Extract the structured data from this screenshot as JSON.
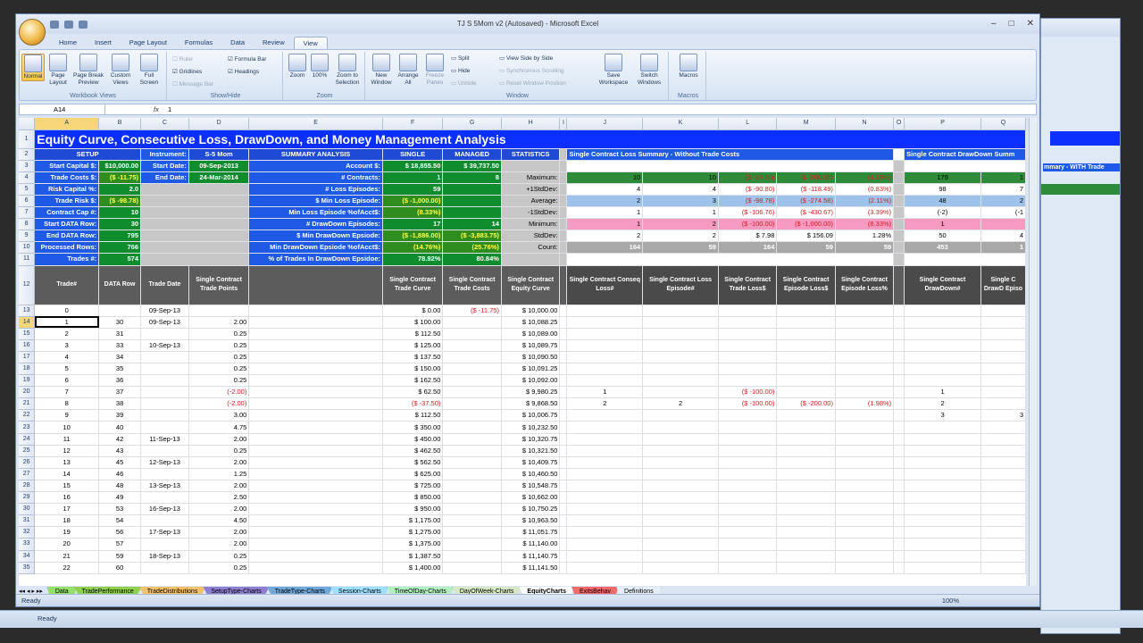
{
  "app": {
    "title": "TJ S 5Mom v2 (Autosaved) - Microsoft Excel",
    "status": "Ready",
    "zoom": "100%"
  },
  "tabs": [
    "Home",
    "Insert",
    "Page Layout",
    "Formulas",
    "Data",
    "Review",
    "View"
  ],
  "ribbon": {
    "workbook_views": {
      "label": "Workbook Views",
      "buttons": [
        "Normal",
        "Page Layout",
        "Page Break Preview",
        "Custom Views",
        "Full Screen"
      ]
    },
    "show_hide": {
      "label": "Show/Hide",
      "items": [
        "Ruler",
        "Formula Bar",
        "Gridlines",
        "Headings",
        "Message Bar"
      ]
    },
    "zoom": {
      "label": "Zoom",
      "buttons": [
        "Zoom",
        "100%",
        "Zoom to Selection"
      ]
    },
    "window": {
      "label": "Window",
      "buttons": [
        "New Window",
        "Arrange All",
        "Freeze Panes",
        "Save Workspace",
        "Switch Windows"
      ],
      "items": [
        "Split",
        "Hide",
        "Unhide",
        "View Side by Side",
        "Synchronous Scrolling",
        "Reset Window Position"
      ]
    },
    "macros": {
      "label": "Macros",
      "buttons": [
        "Macros"
      ]
    }
  },
  "formula": {
    "cell": "A14",
    "fx": "fx",
    "value": "1"
  },
  "columns": [
    "A",
    "B",
    "C",
    "D",
    "E",
    "F",
    "G",
    "H",
    "I",
    "J",
    "K",
    "L",
    "M",
    "N",
    "O",
    "P",
    "Q"
  ],
  "banner": "Equity Curve, Consecutive Loss, DrawDown, and Money Management Analysis",
  "setup": {
    "header": "SETUP",
    "instrument_label": "Instrument:",
    "instrument": "S-5 Mom",
    "rows": [
      [
        "Start Capital $:",
        "$10,000.00",
        "Start Date:",
        "09-Sep-2013"
      ],
      [
        "Trade Costs $:",
        "($ -11.75)",
        "End Date:",
        "24-Mar-2014"
      ],
      [
        "Risk Capital %:",
        "2.0",
        "",
        " "
      ],
      [
        "Trade Risk $:",
        "($ -98.78)",
        "",
        ""
      ],
      [
        "Contract Cap #:",
        "10",
        "",
        ""
      ],
      [
        "Start DATA Row:",
        "30",
        "",
        ""
      ],
      [
        "End DATA Row:",
        "795",
        "",
        ""
      ],
      [
        "Processed Rows:",
        "766",
        "",
        ""
      ],
      [
        "Trades #:",
        "574",
        "",
        ""
      ]
    ]
  },
  "summary": {
    "headers": [
      "SUMMARY ANALYSIS",
      "SINGLE",
      "MANAGED",
      "STATISTICS"
    ],
    "rows": [
      [
        "Account $:",
        "$     18,855.50",
        "$     39,737.50"
      ],
      [
        "# Contracts:",
        "1",
        "8"
      ],
      [
        "# Loss Episodes:",
        "59",
        ""
      ],
      [
        "$ Min Loss Episode:",
        "($     -1,000.00)",
        ""
      ],
      [
        "Min Loss Episode %ofAcct$:",
        "(8.33%)",
        ""
      ],
      [
        "# DrawDown Episodes:",
        "17",
        "14"
      ],
      [
        "$ Min DrawDown Epsiode:",
        "($     -1,886.00)",
        "($     -3,883.75)"
      ],
      [
        "Min DrawDown Epsiode %ofAcct$:",
        "(14.76%)",
        "(25.76%)"
      ],
      [
        "% of Trades In DrawDown Epsidoe:",
        "78.92%",
        "80.84%"
      ]
    ],
    "stats": [
      "Maximum:",
      "+1StdDev:",
      "Average:",
      "-1StdDev:",
      "Minimum:",
      "StdDev:",
      "Count:"
    ]
  },
  "loss_summary": {
    "title": "Single Contract Loss Summary - Without Trade Costs",
    "dd_title": "Single Contract DrawDown Summ",
    "rows": [
      [
        "10",
        "10",
        "($ -37.50)",
        "($ -200.00)",
        "(1.16%)",
        "179",
        "1"
      ],
      [
        "4",
        "4",
        "($ -90.80)",
        "($ -118.49)",
        "(0.83%)",
        "98",
        "7"
      ],
      [
        "2",
        "3",
        "($ -98.78)",
        "($ -274.58)",
        "(2.11%)",
        "48",
        "2"
      ],
      [
        "1",
        "1",
        "($ -106.76)",
        "($ -430.67)",
        "(3.39%)",
        "(-2)",
        "(-1"
      ],
      [
        "1",
        "2",
        "($ -100.00)",
        "($ -1,000.00)",
        "(8.33%)",
        "1",
        ""
      ],
      [
        "2",
        "2",
        "$     7.98",
        "$     156.09",
        "1.28%",
        "50",
        "4"
      ],
      [
        "164",
        "59",
        "164",
        "59",
        "59",
        "453",
        "1"
      ]
    ]
  },
  "table_headers": [
    "Trade#",
    "DATA Row",
    "Trade Date",
    "Single Contract Trade Points",
    "",
    "Single Contract Trade Curve",
    "Single Contract Trade Costs",
    "Single Contract Equity Curve",
    "",
    "Single Contract Conseq Loss#",
    "Single Contract Loss Episode#",
    "Single Contract Trade Loss$",
    "Single Contract Episode Loss$",
    "Single Contract Episode Loss%",
    "",
    "Single Contract DrawDown#",
    "Single C DrawD Episo"
  ],
  "trades": [
    [
      "0",
      "",
      "09-Sep-13",
      "",
      "$ 0.00",
      "($ -11.75)",
      "$ 10,000.00",
      "",
      "",
      "",
      "",
      "",
      "",
      ""
    ],
    [
      "1",
      "30",
      "09-Sep-13",
      "2.00",
      "$ 100.00",
      "",
      "$ 10,088.25",
      "",
      "",
      "",
      "",
      "",
      "",
      ""
    ],
    [
      "2",
      "31",
      "",
      "0.25",
      "$ 112.50",
      "",
      "$ 10,089.00",
      "",
      "",
      "",
      "",
      "",
      "",
      ""
    ],
    [
      "3",
      "33",
      "10-Sep-13",
      "0.25",
      "$ 125.00",
      "",
      "$ 10,089.75",
      "",
      "",
      "",
      "",
      "",
      "",
      ""
    ],
    [
      "4",
      "34",
      "",
      "0.25",
      "$ 137.50",
      "",
      "$ 10,090.50",
      "",
      "",
      "",
      "",
      "",
      "",
      ""
    ],
    [
      "5",
      "35",
      "",
      "0.25",
      "$ 150.00",
      "",
      "$ 10,091.25",
      "",
      "",
      "",
      "",
      "",
      "",
      ""
    ],
    [
      "6",
      "36",
      "",
      "0.25",
      "$ 162.50",
      "",
      "$ 10,092.00",
      "",
      "",
      "",
      "",
      "",
      "",
      ""
    ],
    [
      "7",
      "37",
      "",
      "(-2.00)",
      "$ 62.50",
      "",
      "$ 9,980.25",
      "1",
      "",
      "($ -100.00)",
      "",
      "",
      "1",
      ""
    ],
    [
      "8",
      "38",
      "",
      "(-2.00)",
      "($ -37.50)",
      "",
      "$ 9,868.50",
      "2",
      "2",
      "($ -100.00)",
      "($ -200.00)",
      "(1.98%)",
      "2",
      ""
    ],
    [
      "9",
      "39",
      "",
      "3.00",
      "$ 112.50",
      "",
      "$ 10,006.75",
      "",
      "",
      "",
      "",
      "",
      "3",
      "3"
    ],
    [
      "10",
      "40",
      "",
      "4.75",
      "$ 350.00",
      "",
      "$ 10,232.50",
      "",
      "",
      "",
      "",
      "",
      "",
      ""
    ],
    [
      "11",
      "42",
      "11-Sep-13",
      "2.00",
      "$ 450.00",
      "",
      "$ 10,320.75",
      "",
      "",
      "",
      "",
      "",
      "",
      ""
    ],
    [
      "12",
      "43",
      "",
      "0.25",
      "$ 462.50",
      "",
      "$ 10,321.50",
      "",
      "",
      "",
      "",
      "",
      "",
      ""
    ],
    [
      "13",
      "45",
      "12-Sep-13",
      "2.00",
      "$ 562.50",
      "",
      "$ 10,409.75",
      "",
      "",
      "",
      "",
      "",
      "",
      ""
    ],
    [
      "14",
      "46",
      "",
      "1.25",
      "$ 625.00",
      "",
      "$ 10,460.50",
      "",
      "",
      "",
      "",
      "",
      "",
      ""
    ],
    [
      "15",
      "48",
      "13-Sep-13",
      "2.00",
      "$ 725.00",
      "",
      "$ 10,548.75",
      "",
      "",
      "",
      "",
      "",
      "",
      ""
    ],
    [
      "16",
      "49",
      "",
      "2.50",
      "$ 850.00",
      "",
      "$ 10,662.00",
      "",
      "",
      "",
      "",
      "",
      "",
      ""
    ],
    [
      "17",
      "53",
      "16-Sep-13",
      "2.00",
      "$ 950.00",
      "",
      "$ 10,750.25",
      "",
      "",
      "",
      "",
      "",
      "",
      ""
    ],
    [
      "18",
      "54",
      "",
      "4.50",
      "$ 1,175.00",
      "",
      "$ 10,963.50",
      "",
      "",
      "",
      "",
      "",
      "",
      ""
    ],
    [
      "19",
      "56",
      "17-Sep-13",
      "2.00",
      "$ 1,275.00",
      "",
      "$ 11,051.75",
      "",
      "",
      "",
      "",
      "",
      "",
      ""
    ],
    [
      "20",
      "57",
      "",
      "2.00",
      "$ 1,375.00",
      "",
      "$ 11,140.00",
      "",
      "",
      "",
      "",
      "",
      "",
      ""
    ],
    [
      "21",
      "59",
      "18-Sep-13",
      "0.25",
      "$ 1,387.50",
      "",
      "$ 11,140.75",
      "",
      "",
      "",
      "",
      "",
      "",
      ""
    ],
    [
      "22",
      "60",
      "",
      "0.25",
      "$ 1,400.00",
      "",
      "$ 11,141.50",
      "",
      "",
      "",
      "",
      "",
      "",
      ""
    ]
  ],
  "sheet_tabs": [
    "Data",
    "TradePerformance",
    "TradeDistributions",
    "SetupType-Charts",
    "TradeType-Charts",
    "Session-Charts",
    "TimeOfDay-Charts",
    "DayOfWeek-Charts",
    "EquityCharts",
    "ExitsBehav",
    "Definitions"
  ],
  "active_sheet": "EquityCharts",
  "bg_window": {
    "title_fragment": "mmary - WITH Trade",
    "col_labels": [
      "Q",
      "R"
    ],
    "cells": [
      "79",
      "71",
      "27",
      "17)",
      "3",
      "44",
      "17",
      "45"
    ]
  }
}
